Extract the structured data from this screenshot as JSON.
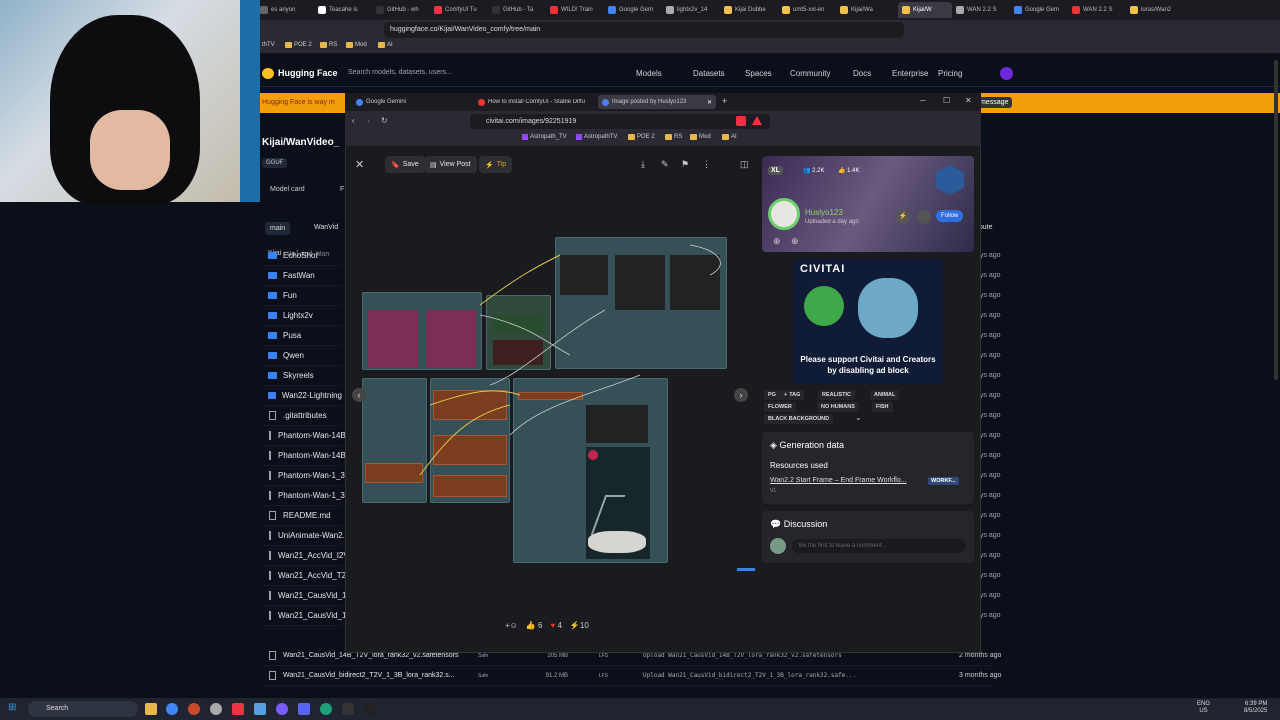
{
  "back_browser": {
    "tabs": [
      {
        "label": "es anyon"
      },
      {
        "label": "Teacahe is"
      },
      {
        "label": "GitHub - wh"
      },
      {
        "label": "ComfyUI Tu"
      },
      {
        "label": "GitHub - Ta"
      },
      {
        "label": "WILD! Train"
      },
      {
        "label": "Google Gem"
      },
      {
        "label": "lightx2v_14"
      },
      {
        "label": "Kijai Dubbe"
      },
      {
        "label": "umt5-xxl-en"
      },
      {
        "label": "Kijai/Wa"
      },
      {
        "label": "Kijai/W"
      },
      {
        "label": "WAN 2.2 S"
      },
      {
        "label": "Google Gem"
      },
      {
        "label": "WAN 2.2 S"
      },
      {
        "label": "loras/Wan2"
      }
    ],
    "url": "huggingface.co/Kijai/WanVideo_comfy/tree/main",
    "bookmarks": [
      "thTV",
      "POE 2",
      "RS",
      "Mod",
      "AI"
    ]
  },
  "hf": {
    "brand": "Hugging Face",
    "search_placeholder": "Search models, datasets, users...",
    "nav": [
      "Models",
      "Datasets",
      "Spaces",
      "Community",
      "Docs",
      "Enterprise",
      "Pricing"
    ],
    "banner": "Hugging Face is way m",
    "banner_right": "message",
    "repo_title": "Kijai/WanVideo_",
    "tag": "GGUF",
    "tab_model_card": "Model card",
    "tab_files": "F",
    "branch": "main",
    "path": "WanVid",
    "commit_user": "Kijai",
    "commit_msg": "Upload Wan",
    "contribute": "ribute",
    "rows": [
      {
        "name": "EchoShot",
        "type": "folder",
        "ago": "ays ago"
      },
      {
        "name": "FastWan",
        "type": "folder",
        "ago": "ays ago"
      },
      {
        "name": "Fun",
        "type": "folder",
        "ago": "ays ago"
      },
      {
        "name": "Lightx2v",
        "type": "folder",
        "ago": "ays ago"
      },
      {
        "name": "Pusa",
        "type": "folder",
        "ago": "ays ago"
      },
      {
        "name": "Qwen",
        "type": "folder",
        "ago": "ays ago"
      },
      {
        "name": "Skyreels",
        "type": "folder",
        "ago": "ays ago"
      },
      {
        "name": "Wan22-Lightning",
        "type": "folder",
        "ago": "ays ago"
      },
      {
        "name": ".gitattributes",
        "type": "file",
        "ago": "ays ago"
      },
      {
        "name": "Phantom-Wan-14B",
        "type": "file",
        "ago": "ays ago"
      },
      {
        "name": "Phantom-Wan-14B",
        "type": "file",
        "ago": "ays ago"
      },
      {
        "name": "Phantom-Wan-1_3E",
        "type": "file",
        "ago": "ays ago"
      },
      {
        "name": "Phantom-Wan-1_3E",
        "type": "file",
        "ago": "ays ago"
      },
      {
        "name": "README.md",
        "type": "file",
        "ago": "ays ago"
      },
      {
        "name": "UniAnimate-Wan2.1",
        "type": "file",
        "ago": "ays ago"
      },
      {
        "name": "Wan21_AccVid_I2V_",
        "type": "file",
        "ago": "ays ago"
      },
      {
        "name": "Wan21_AccVid_T2V_",
        "type": "file",
        "ago": "ays ago"
      },
      {
        "name": "Wan21_CausVid_14",
        "type": "file",
        "ago": "ays ago"
      },
      {
        "name": "Wan21_CausVid_14",
        "type": "file",
        "ago": "ays ago"
      }
    ],
    "bottom_rows": [
      {
        "name": "Wan21_CausVid_14B_T2V_lora_rank32_v2.safetensors",
        "safe": "Safe",
        "size": "205 MB",
        "lfs": "LFS",
        "msg": "Upload Wan21_CausVid_14B_T2V_lora_rank32_v2.safetensors",
        "ago": "2 months ago"
      },
      {
        "name": "Wan21_CausVid_bidirect2_T2V_1_3B_lora_rank32.s...",
        "safe": "Safe",
        "size": "91.2 MB",
        "lfs": "LFS",
        "msg": "Upload Wan21_CausVid_bidirect2_T2V_1_3B_lora_rank32.safe...",
        "ago": "3 months ago"
      }
    ]
  },
  "front": {
    "tabs": [
      "Google Gemini",
      "How to install ComfyUI - Stable Diffu",
      "Image posted by Huslyo123"
    ],
    "url": "civitai.com/images/92251919",
    "bookmarks": [
      "Astropath_TV",
      "AstropathTV",
      "POE 2",
      "RS",
      "Mod",
      "AI"
    ],
    "toolbar": {
      "save": "Save",
      "view_post": "View Post",
      "tip": "Tip"
    },
    "profile": {
      "badge": "XL",
      "followers": "2.2K",
      "likes": "1.4K",
      "username": "Huslyo123",
      "uploaded": "Uploaded a day ago",
      "follow": "Follow"
    },
    "ad": {
      "logo": "CIVITAI",
      "text": "Please support Civitai and Creators by disabling ad block"
    },
    "tags": [
      "PG",
      "TAG",
      "REALISTIC",
      "ANIMAL",
      "FLOWER",
      "NO HUMANS",
      "FISH",
      "BLACK BACKGROUND"
    ],
    "generation": {
      "title": "Generation data",
      "resources_title": "Resources used",
      "resource": "Wan2.2 Start Frame – End Frame Workflo...",
      "resource_badge": "WORKF...",
      "version": "V1"
    },
    "discussion": {
      "title": "Discussion",
      "placeholder": "Be the first to leave a comment..."
    },
    "reactions": {
      "r1": "6",
      "r2": "4",
      "r3": "10"
    }
  },
  "taskbar": {
    "search": "Search",
    "lang1": "ENG",
    "lang2": "US",
    "time": "6:39 PM",
    "date": "8/5/2025"
  }
}
